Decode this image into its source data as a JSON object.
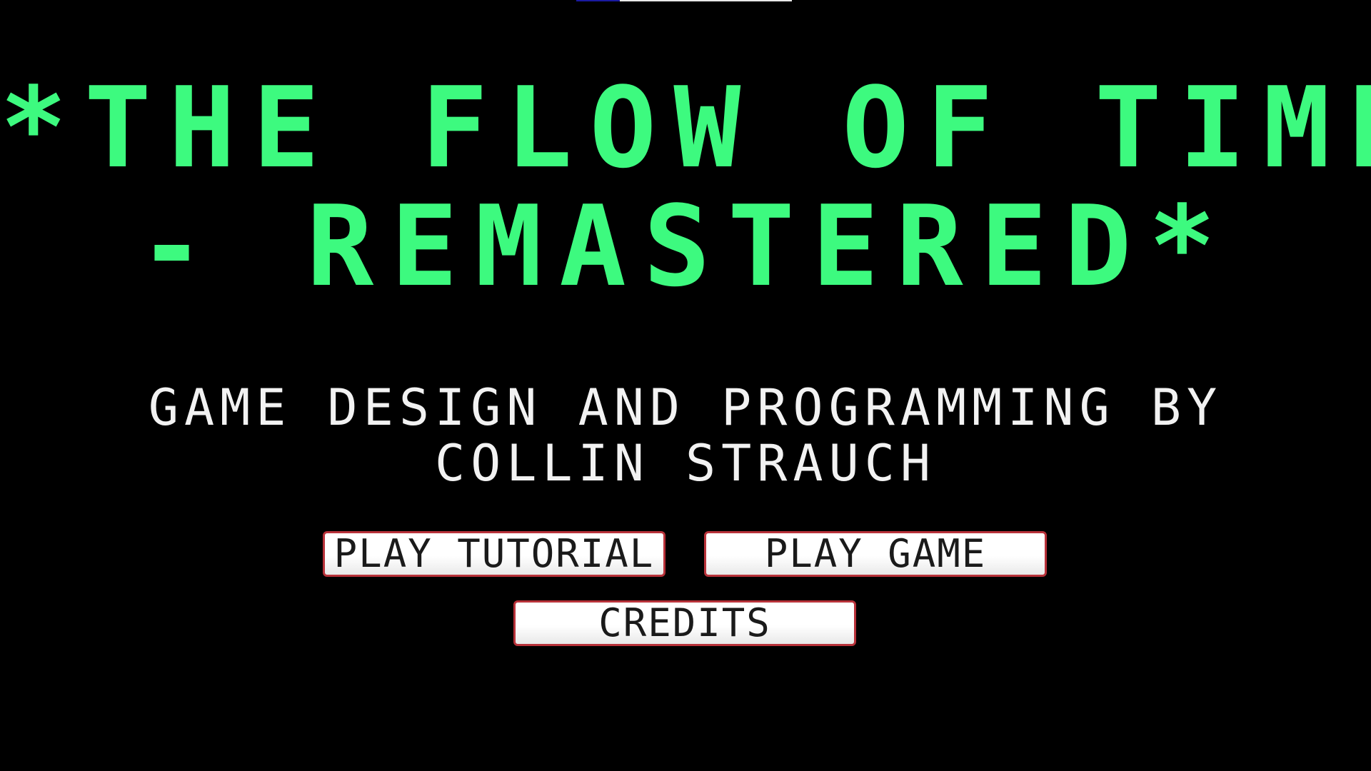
{
  "title": {
    "line1": "*THE FLOW OF TIME",
    "line2": "- REMASTERED*"
  },
  "subtitle": "GAME DESIGN AND PROGRAMMING BY COLLIN STRAUCH",
  "menu": {
    "play_tutorial": "PLAY TUTORIAL",
    "play_game": "PLAY GAME",
    "credits": "CREDITS"
  },
  "colors": {
    "background": "#000000",
    "title": "#3dfa7f",
    "subtitle": "#f2f2f2",
    "button_border": "#b8323a",
    "button_fill": "#ffffff"
  }
}
